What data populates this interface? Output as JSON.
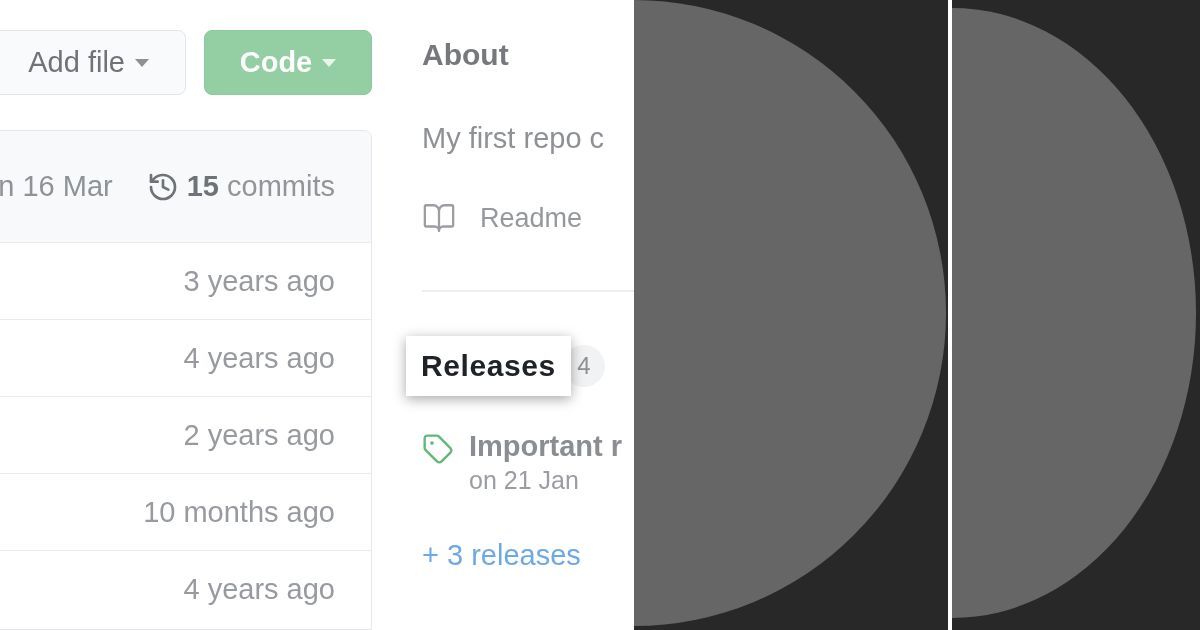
{
  "toolbar": {
    "buttons": [
      {
        "kind": "secondary",
        "label": "Add file"
      },
      {
        "kind": "primary",
        "label": "Code"
      }
    ]
  },
  "files": {
    "latest_commit_date": "n 16 Mar",
    "commits_link": "**15** commits",
    "rows": [
      {
        "age": "3 years ago"
      },
      {
        "age": "4 years ago"
      },
      {
        "age": "2 years ago"
      },
      {
        "age": "10 months ago"
      },
      {
        "age": "4 years ago"
      }
    ]
  },
  "about": {
    "title": "About",
    "description": "My first repo c",
    "readme_link": "Readme"
  },
  "releases": {
    "title": "Releases",
    "count": "4",
    "spotlight": true,
    "latest": {
      "name": "Important r",
      "date": "on 21 Jan"
    },
    "more_link": "+ 3 releases"
  }
}
